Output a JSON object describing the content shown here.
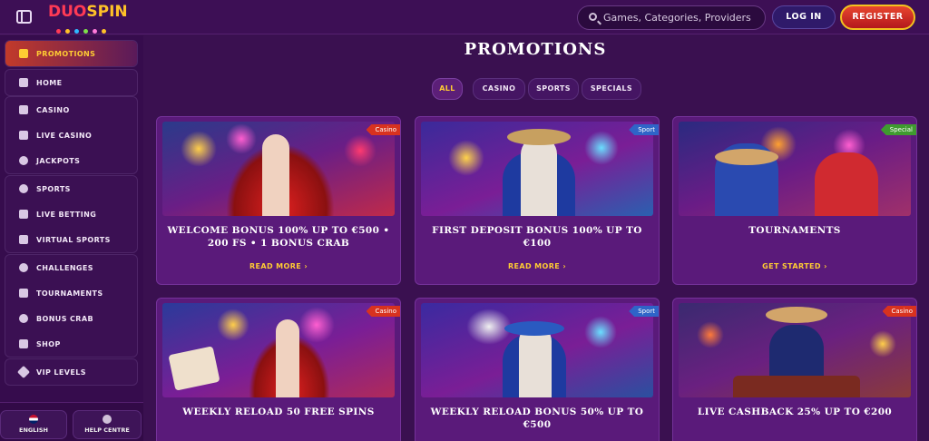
{
  "header": {
    "logo_duo": "DUO",
    "logo_spin": "SPIN",
    "search_placeholder": "Games, Categories, Providers",
    "login_label": "LOG IN",
    "register_label": "REGISTER"
  },
  "sidebar": {
    "groups": [
      [
        {
          "label": "PROMOTIONS",
          "icon": "gift-icon",
          "active": true
        }
      ],
      [
        {
          "label": "HOME",
          "icon": "home-icon"
        }
      ],
      [
        {
          "label": "CASINO",
          "icon": "slot-machine-icon"
        },
        {
          "label": "LIVE CASINO",
          "icon": "card-icon"
        },
        {
          "label": "JACKPOTS",
          "icon": "clover-icon"
        }
      ],
      [
        {
          "label": "SPORTS",
          "icon": "ball-icon"
        },
        {
          "label": "LIVE BETTING",
          "icon": "play-icon"
        },
        {
          "label": "VIRTUAL SPORTS",
          "icon": "monitor-icon"
        }
      ],
      [
        {
          "label": "CHALLENGES",
          "icon": "medal-icon"
        },
        {
          "label": "TOURNAMENTS",
          "icon": "trophy-icon"
        },
        {
          "label": "BONUS CRAB",
          "icon": "crab-icon"
        },
        {
          "label": "SHOP",
          "icon": "cart-icon"
        }
      ],
      [
        {
          "label": "VIP LEVELS",
          "icon": "diamond-icon"
        }
      ]
    ],
    "language_label": "ENGLISH",
    "help_label": "HELP CENTRE"
  },
  "main": {
    "title": "PROMOTIONS",
    "filters": [
      "ALL",
      "CASINO",
      "SPORTS",
      "SPECIALS"
    ],
    "active_filter": "ALL",
    "cards": [
      {
        "tag": "Casino",
        "title": "WELCOME BONUS 100% UP TO €500 • 200 FS • 1 BONUS CRAB",
        "cta": "READ MORE"
      },
      {
        "tag": "Sport",
        "title": "FIRST DEPOSIT BONUS 100% UP TO €100",
        "cta": "READ MORE"
      },
      {
        "tag": "Special",
        "title": "TOURNAMENTS",
        "cta": "GET STARTED"
      },
      {
        "tag": "Casino",
        "title": "WEEKLY RELOAD 50 FREE SPINS",
        "cta": ""
      },
      {
        "tag": "Sport",
        "title": "WEEKLY RELOAD BONUS 50% UP TO €500",
        "cta": ""
      },
      {
        "tag": "Casino",
        "title": "LIVE CASHBACK 25% UP TO €200",
        "cta": ""
      }
    ]
  },
  "colors": {
    "accent": "#ffcc33",
    "casino_tag": "#d8321f",
    "sport_tag": "#2f64c8",
    "special_tag": "#3f9a2f"
  }
}
